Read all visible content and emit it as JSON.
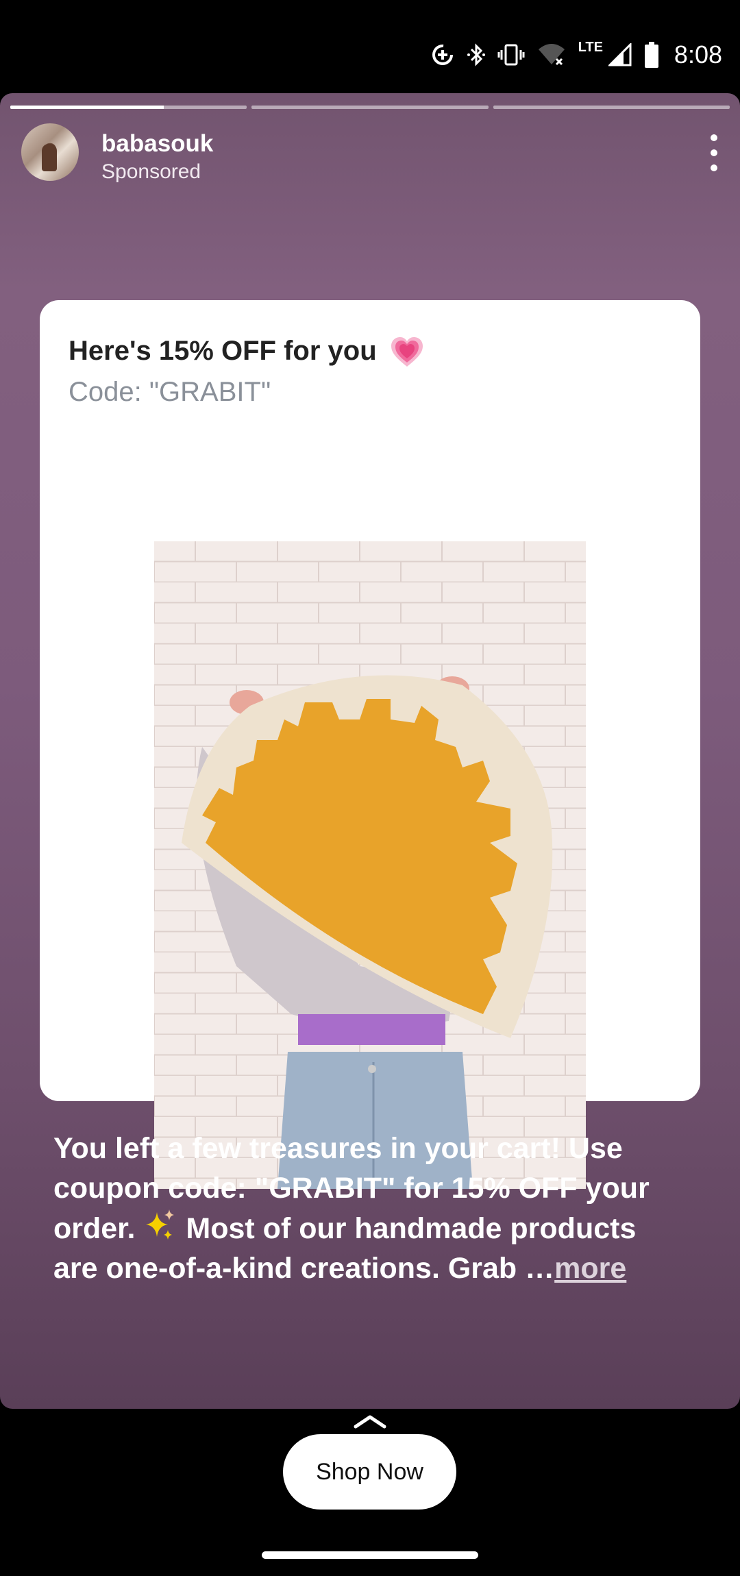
{
  "status_bar": {
    "time": "8:08",
    "network": "LTE",
    "icons": [
      "data-saver-icon",
      "bluetooth-icon",
      "vibrate-icon",
      "wifi-off-icon",
      "cell-signal-icon",
      "battery-icon"
    ]
  },
  "story": {
    "progress_segments": [
      0.65,
      0,
      0
    ],
    "username": "babasouk",
    "subtitle": "Sponsored",
    "menu_icon": "more-vertical-icon"
  },
  "card": {
    "title": "Here's 15% OFF for you",
    "title_emoji": "pink-heart-icon",
    "code": "Code: \"GRABIT\"",
    "image_alt": "Person holding an orange and cream sun-shaped tufted rug against a white brick wall"
  },
  "caption": {
    "line1": "You left a few treasures in your cart! Use",
    "line2": "coupon code: \"GRABIT\" for 15% OFF your",
    "line3_a": "order.",
    "line3_b": "Most of our handmade products",
    "line4": "are one-of-a-kind creations. Grab …",
    "more_label": "more"
  },
  "cta": {
    "label": "Shop Now",
    "swipe_icon": "chevron-up-icon"
  },
  "colors": {
    "story_bg_top": "#72546f",
    "story_bg_bottom": "#5a3f58",
    "code_text": "#8a9099"
  }
}
